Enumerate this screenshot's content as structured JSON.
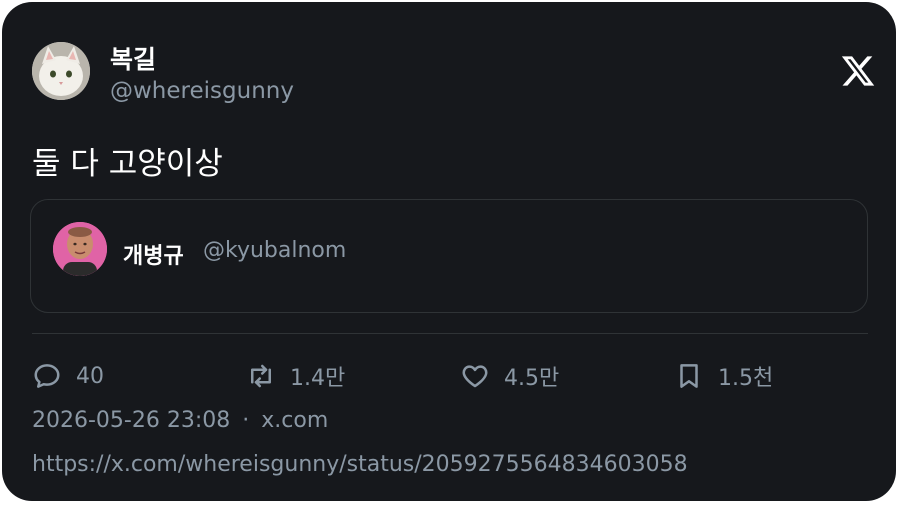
{
  "author": {
    "display_name": "복길",
    "handle": "@whereisgunny",
    "avatar": "cat-avatar"
  },
  "brand_icon": "x-logo-icon",
  "tweet": {
    "text": "둘 다 고양이상"
  },
  "quoted": {
    "display_name": "개병규",
    "handle": "@kyubalnom",
    "avatar": "person-avatar"
  },
  "actions": {
    "replies": "40",
    "reposts": "1.4만",
    "likes": "4.5만",
    "bookmarks": "1.5천"
  },
  "meta": {
    "timestamp": "2026-05-26 23:08",
    "separator": "·",
    "source": "x.com"
  },
  "url": "https://x.com/whereisgunny/status/2059275564834603058",
  "colors": {
    "card_bg": "#16181c",
    "text_primary": "#e7e9ea",
    "text_secondary": "#8b98a5",
    "border": "#2f3336"
  }
}
